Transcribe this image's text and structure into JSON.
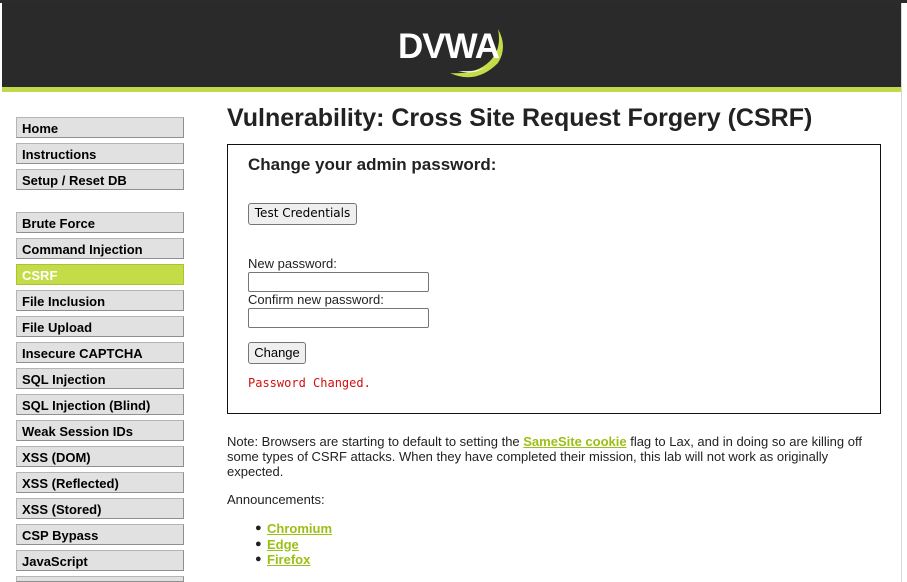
{
  "header": {
    "logo_text": "DVWA"
  },
  "menu": {
    "items": [
      {
        "label": "Home"
      },
      {
        "label": "Instructions"
      },
      {
        "label": "Setup / Reset DB"
      },
      {
        "label": "Brute Force"
      },
      {
        "label": "Command Injection"
      },
      {
        "label": "CSRF",
        "selected": true
      },
      {
        "label": "File Inclusion"
      },
      {
        "label": "File Upload"
      },
      {
        "label": "Insecure CAPTCHA"
      },
      {
        "label": "SQL Injection"
      },
      {
        "label": "SQL Injection (Blind)"
      },
      {
        "label": "Weak Session IDs"
      },
      {
        "label": "XSS (DOM)"
      },
      {
        "label": "XSS (Reflected)"
      },
      {
        "label": "XSS (Stored)"
      },
      {
        "label": "CSP Bypass"
      },
      {
        "label": "JavaScript"
      }
    ]
  },
  "main": {
    "title": "Vulnerability: Cross Site Request Forgery (CSRF)",
    "form": {
      "heading": "Change your admin password:",
      "test_button": "Test Credentials",
      "new_password_label": "New password:",
      "new_password_value": "",
      "confirm_password_label": "Confirm new password:",
      "confirm_password_value": "",
      "change_button": "Change",
      "status_message": "Password Changed."
    },
    "note": {
      "prefix": "Note: Browsers are starting to default to setting the ",
      "link": "SameSite cookie",
      "suffix": " flag to Lax, and in doing so are killing off some types of CSRF attacks. When they have completed their mission, this lab will not work as originally expected."
    },
    "announcements": {
      "title": "Announcements:",
      "items": [
        "Chromium",
        "Edge",
        "Firefox"
      ]
    }
  },
  "colors": {
    "header_bg": "#2a2a2a",
    "accent_green": "#c3dc47",
    "link_green": "#9bbf16",
    "status_red": "#d01010"
  }
}
